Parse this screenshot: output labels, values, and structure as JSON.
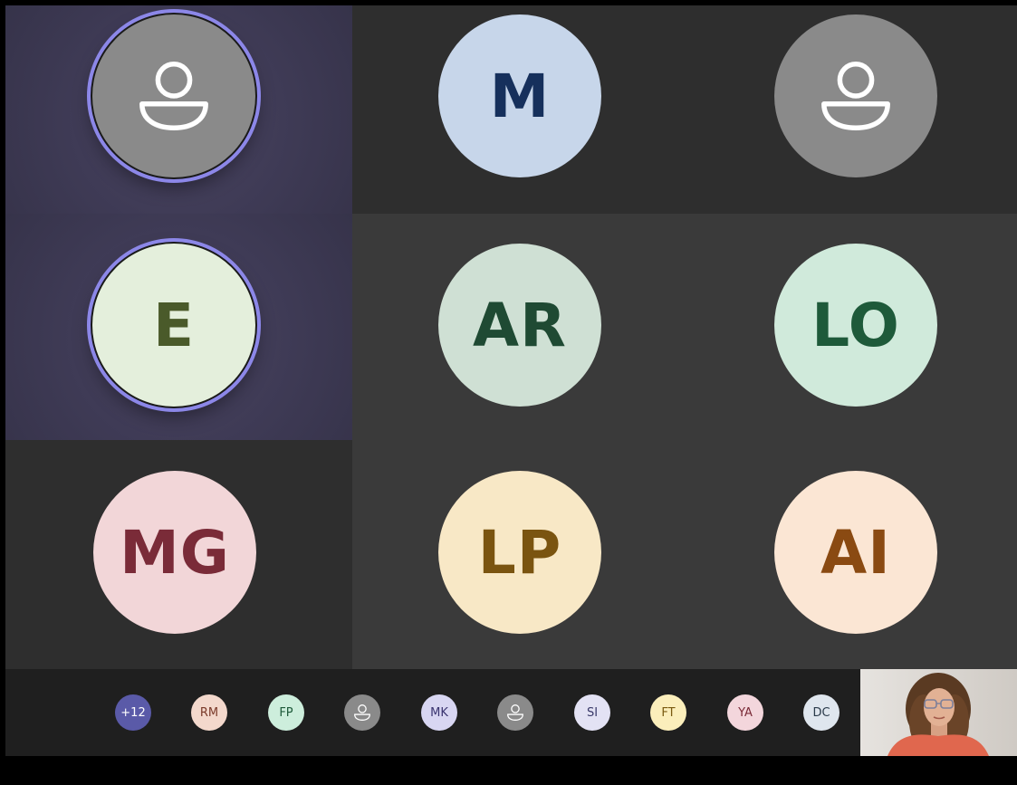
{
  "tiles": [
    {
      "kind": "icon",
      "bg": "#8a8a8a",
      "fg": "#ffffff",
      "speaking": true,
      "tile": "active"
    },
    {
      "kind": "initials",
      "label": "M",
      "bg": "#c7d6ea",
      "fg": "#16305c",
      "tile": "dark"
    },
    {
      "kind": "icon",
      "bg": "#8a8a8a",
      "fg": "#ffffff",
      "tile": "dark"
    },
    {
      "kind": "initials",
      "label": "E",
      "bg": "#e4efdc",
      "fg": "#4a5a2a",
      "speaking": true,
      "tile": "active"
    },
    {
      "kind": "initials",
      "label": "AR",
      "bg": "#cfe0d4",
      "fg": "#1f4a33",
      "tile": "normal"
    },
    {
      "kind": "initials",
      "label": "LO",
      "bg": "#d0eadb",
      "fg": "#1e5a3a",
      "tile": "normal"
    },
    {
      "kind": "initials",
      "label": "MG",
      "bg": "#f2d6d8",
      "fg": "#7a2b38",
      "tile": "dark"
    },
    {
      "kind": "initials",
      "label": "LP",
      "bg": "#f8e8c6",
      "fg": "#7a5410",
      "tile": "normal"
    },
    {
      "kind": "initials",
      "label": "AI",
      "bg": "#fbe6d4",
      "fg": "#8a4a12",
      "tile": "normal"
    }
  ],
  "strip": {
    "participants": [
      {
        "label": "+12",
        "bg": "#5a5aa8",
        "fg": "#ffffff"
      },
      {
        "label": "RM",
        "bg": "#f3d8cc",
        "fg": "#7a3a2a"
      },
      {
        "label": "FP",
        "bg": "#cdeedc",
        "fg": "#1e5a3a"
      },
      {
        "label": "",
        "icon": "person-icon",
        "bg": "#8a8a8a",
        "fg": "#ffffff"
      },
      {
        "label": "MK",
        "bg": "#d8d6f2",
        "fg": "#3a3470"
      },
      {
        "label": "",
        "icon": "person-icon",
        "bg": "#8a8a8a",
        "fg": "#ffffff"
      },
      {
        "label": "SI",
        "bg": "#e3e2f4",
        "fg": "#3a3a6a"
      },
      {
        "label": "FT",
        "bg": "#fbeebb",
        "fg": "#7a5a10"
      },
      {
        "label": "YA",
        "bg": "#f3d6dc",
        "fg": "#7a2b38"
      },
      {
        "label": "DC",
        "bg": "#dfe6ee",
        "fg": "#2a3a4a"
      }
    ]
  },
  "selfview": {
    "accent": "#e0674e"
  }
}
